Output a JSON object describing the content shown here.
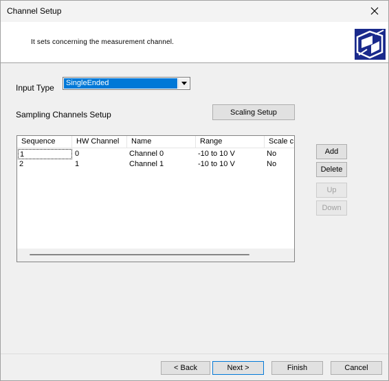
{
  "window": {
    "title": "Channel Setup"
  },
  "header": {
    "description": "It sets concerning the measurement channel."
  },
  "input_type": {
    "label": "Input Type",
    "value": "SingleEnded"
  },
  "sampling": {
    "label": "Sampling Channels Setup",
    "scaling_button": "Scaling Setup"
  },
  "table": {
    "columns": [
      "Sequence",
      "HW Channel",
      "Name",
      "Range",
      "Scale c"
    ],
    "rows": [
      [
        "1",
        "0",
        "Channel 0",
        "-10 to 10 V",
        "No"
      ],
      [
        "2",
        "1",
        "Channel 1",
        "-10 to 10 V",
        "No"
      ]
    ]
  },
  "side_buttons": {
    "add": "Add",
    "delete": "Delete",
    "up": "Up",
    "down": "Down"
  },
  "footer": {
    "back": "< Back",
    "next": "Next >",
    "finish": "Finish",
    "cancel": "Cancel"
  },
  "colors": {
    "selection": "#0078d7",
    "logo": "#1a2a8c"
  }
}
